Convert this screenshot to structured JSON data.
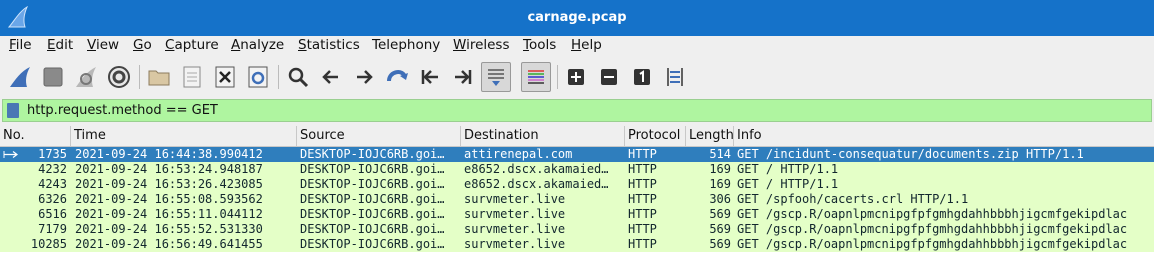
{
  "window": {
    "title": "carnage.pcap"
  },
  "menu": [
    {
      "label": "File",
      "u": "F",
      "rest": "ile"
    },
    {
      "label": "Edit",
      "u": "E",
      "rest": "dit"
    },
    {
      "label": "View",
      "u": "V",
      "rest": "iew"
    },
    {
      "label": "Go",
      "u": "G",
      "rest": "o"
    },
    {
      "label": "Capture",
      "u": "C",
      "rest": "apture"
    },
    {
      "label": "Analyze",
      "u": "A",
      "rest": "nalyze"
    },
    {
      "label": "Statistics",
      "u": "S",
      "rest": "tatistics"
    },
    {
      "label": "Telephony",
      "u": "",
      "rest": "Telephony"
    },
    {
      "label": "Wireless",
      "u": "W",
      "rest": "ireless"
    },
    {
      "label": "Tools",
      "u": "T",
      "rest": "ools"
    },
    {
      "label": "Help",
      "u": "H",
      "rest": "elp"
    }
  ],
  "toolbar": {
    "icons": [
      "start-capture-icon",
      "stop-capture-icon",
      "restart-capture-icon",
      "capture-options-icon",
      "open-file-icon",
      "save-file-icon",
      "close-file-icon",
      "reload-file-icon",
      "find-packet-icon",
      "go-back-icon",
      "go-forward-icon",
      "go-to-packet-icon",
      "first-packet-icon",
      "last-packet-icon",
      "auto-scroll-icon",
      "colorize-icon",
      "zoom-in-icon",
      "zoom-out-icon",
      "normal-size-icon",
      "resize-columns-icon"
    ]
  },
  "filter": {
    "value": "http.request.method == GET",
    "bg_color": "#aff5a0"
  },
  "columns": [
    "No.",
    "Time",
    "Source",
    "Destination",
    "Protocol",
    "Length",
    "Info"
  ],
  "packets": [
    {
      "no": "1735",
      "time": "2021-09-24 16:44:38.990412",
      "source": "DESKTOP-IOJC6RB.goi…",
      "destination": "attirenepal.com",
      "protocol": "HTTP",
      "length": "514",
      "info": "GET /incidunt-consequatur/documents.zip HTTP/1.1",
      "selected": true
    },
    {
      "no": "4232",
      "time": "2021-09-24 16:53:24.948187",
      "source": "DESKTOP-IOJC6RB.goi…",
      "destination": "e8652.dscx.akamaied…",
      "protocol": "HTTP",
      "length": "169",
      "info": "GET / HTTP/1.1"
    },
    {
      "no": "4243",
      "time": "2021-09-24 16:53:26.423085",
      "source": "DESKTOP-IOJC6RB.goi…",
      "destination": "e8652.dscx.akamaied…",
      "protocol": "HTTP",
      "length": "169",
      "info": "GET / HTTP/1.1"
    },
    {
      "no": "6326",
      "time": "2021-09-24 16:55:08.593562",
      "source": "DESKTOP-IOJC6RB.goi…",
      "destination": "survmeter.live",
      "protocol": "HTTP",
      "length": "306",
      "info": "GET /spfooh/cacerts.crl HTTP/1.1"
    },
    {
      "no": "6516",
      "time": "2021-09-24 16:55:11.044112",
      "source": "DESKTOP-IOJC6RB.goi…",
      "destination": "survmeter.live",
      "protocol": "HTTP",
      "length": "569",
      "info": "GET /gscp.R/oapnlpmcnipgfpfgmhgdahhbbbhjigcmfgekipdlac"
    },
    {
      "no": "7179",
      "time": "2021-09-24 16:55:52.531330",
      "source": "DESKTOP-IOJC6RB.goi…",
      "destination": "survmeter.live",
      "protocol": "HTTP",
      "length": "569",
      "info": "GET /gscp.R/oapnlpmcnipgfpfgmhgdahhbbbhjigcmfgekipdlac"
    },
    {
      "no": "10285",
      "time": "2021-09-24 16:56:49.641455",
      "source": "DESKTOP-IOJC6RB.goi…",
      "destination": "survmeter.live",
      "protocol": "HTTP",
      "length": "569",
      "info": "GET /gscp.R/oapnlpmcnipgfpfgmhgdahhbbbhjigcmfgekipdlac"
    }
  ],
  "colors": {
    "titlebar": "#1572c9",
    "row_http": "#e4ffc7",
    "row_selected": "#2f7ebd"
  }
}
